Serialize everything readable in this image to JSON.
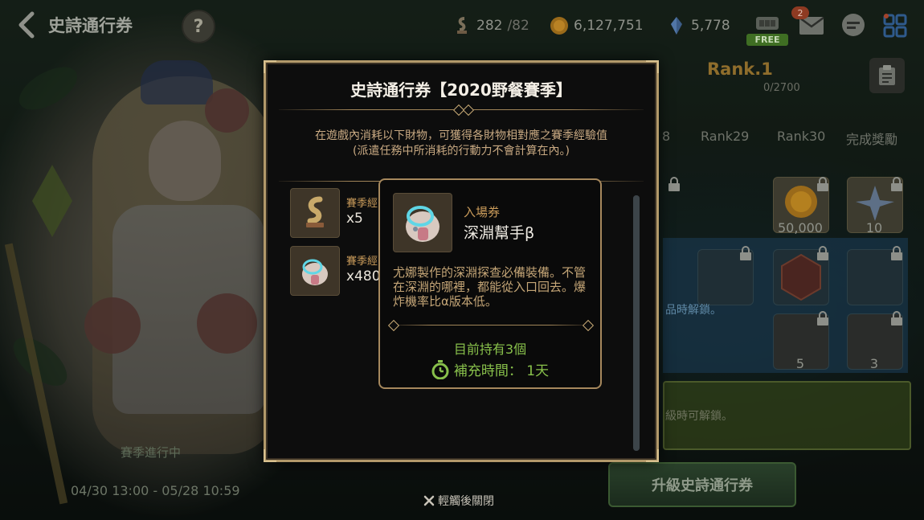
{
  "topbar": {
    "title": "史詩通行券",
    "help": "?",
    "resources": {
      "season_xp": {
        "current": "282",
        "max": "/82",
        "icon": "season-xp-icon"
      },
      "gold": {
        "value": "6,127,751",
        "icon": "gold-coin-icon"
      },
      "crystal": {
        "value": "5,778",
        "icon": "crystal-icon"
      }
    },
    "mail_badge": "2",
    "free_label": "FREE"
  },
  "left_panel": {
    "season_status": "賽季進行中",
    "season_dates": "04/30 13:00 - 05/28 10:59"
  },
  "pass_panel": {
    "rank_title": "Rank.1",
    "rank_xp": "0/2700",
    "rank_columns": [
      "8",
      "Rank29",
      "Rank30",
      "完成獎勵"
    ],
    "reward_qty": [
      "50,000",
      "10"
    ],
    "lower_qty": [
      "5",
      "3"
    ],
    "unlock_note_blue": "品時解鎖。",
    "unlock_note_green": "級時可解鎖。",
    "upgrade_button": "升級史詩通行券"
  },
  "modal": {
    "title": "史詩通行券【2020野餐賽季】",
    "desc_line1": "在遊戲內消耗以下財物，可獲得各財物相對應之賽季經驗值",
    "desc_line2": "(派遣任務中所消耗的行動力不會計算在內。)",
    "items": [
      {
        "label": "賽季經",
        "qty": "x5",
        "icon": "season-xp-icon"
      },
      {
        "label": "賽季經",
        "qty": "x480",
        "icon": "abyss-helper-icon"
      }
    ]
  },
  "tooltip": {
    "category": "入場券",
    "name": "深淵幫手β",
    "desc": "尤娜製作的深淵探查必備裝備。不管在深淵的哪裡，都能從入口回去。爆炸機率比α版本低。",
    "owned": "目前持有3個",
    "refill": "補充時間：  1天"
  },
  "close_hint": "輕觸後關閉",
  "colors": {
    "frame_gold": "#b2996a",
    "accent_orange": "#c99b5a",
    "accent_green": "#88c04b",
    "modal_bg": "#0d0d0d"
  }
}
